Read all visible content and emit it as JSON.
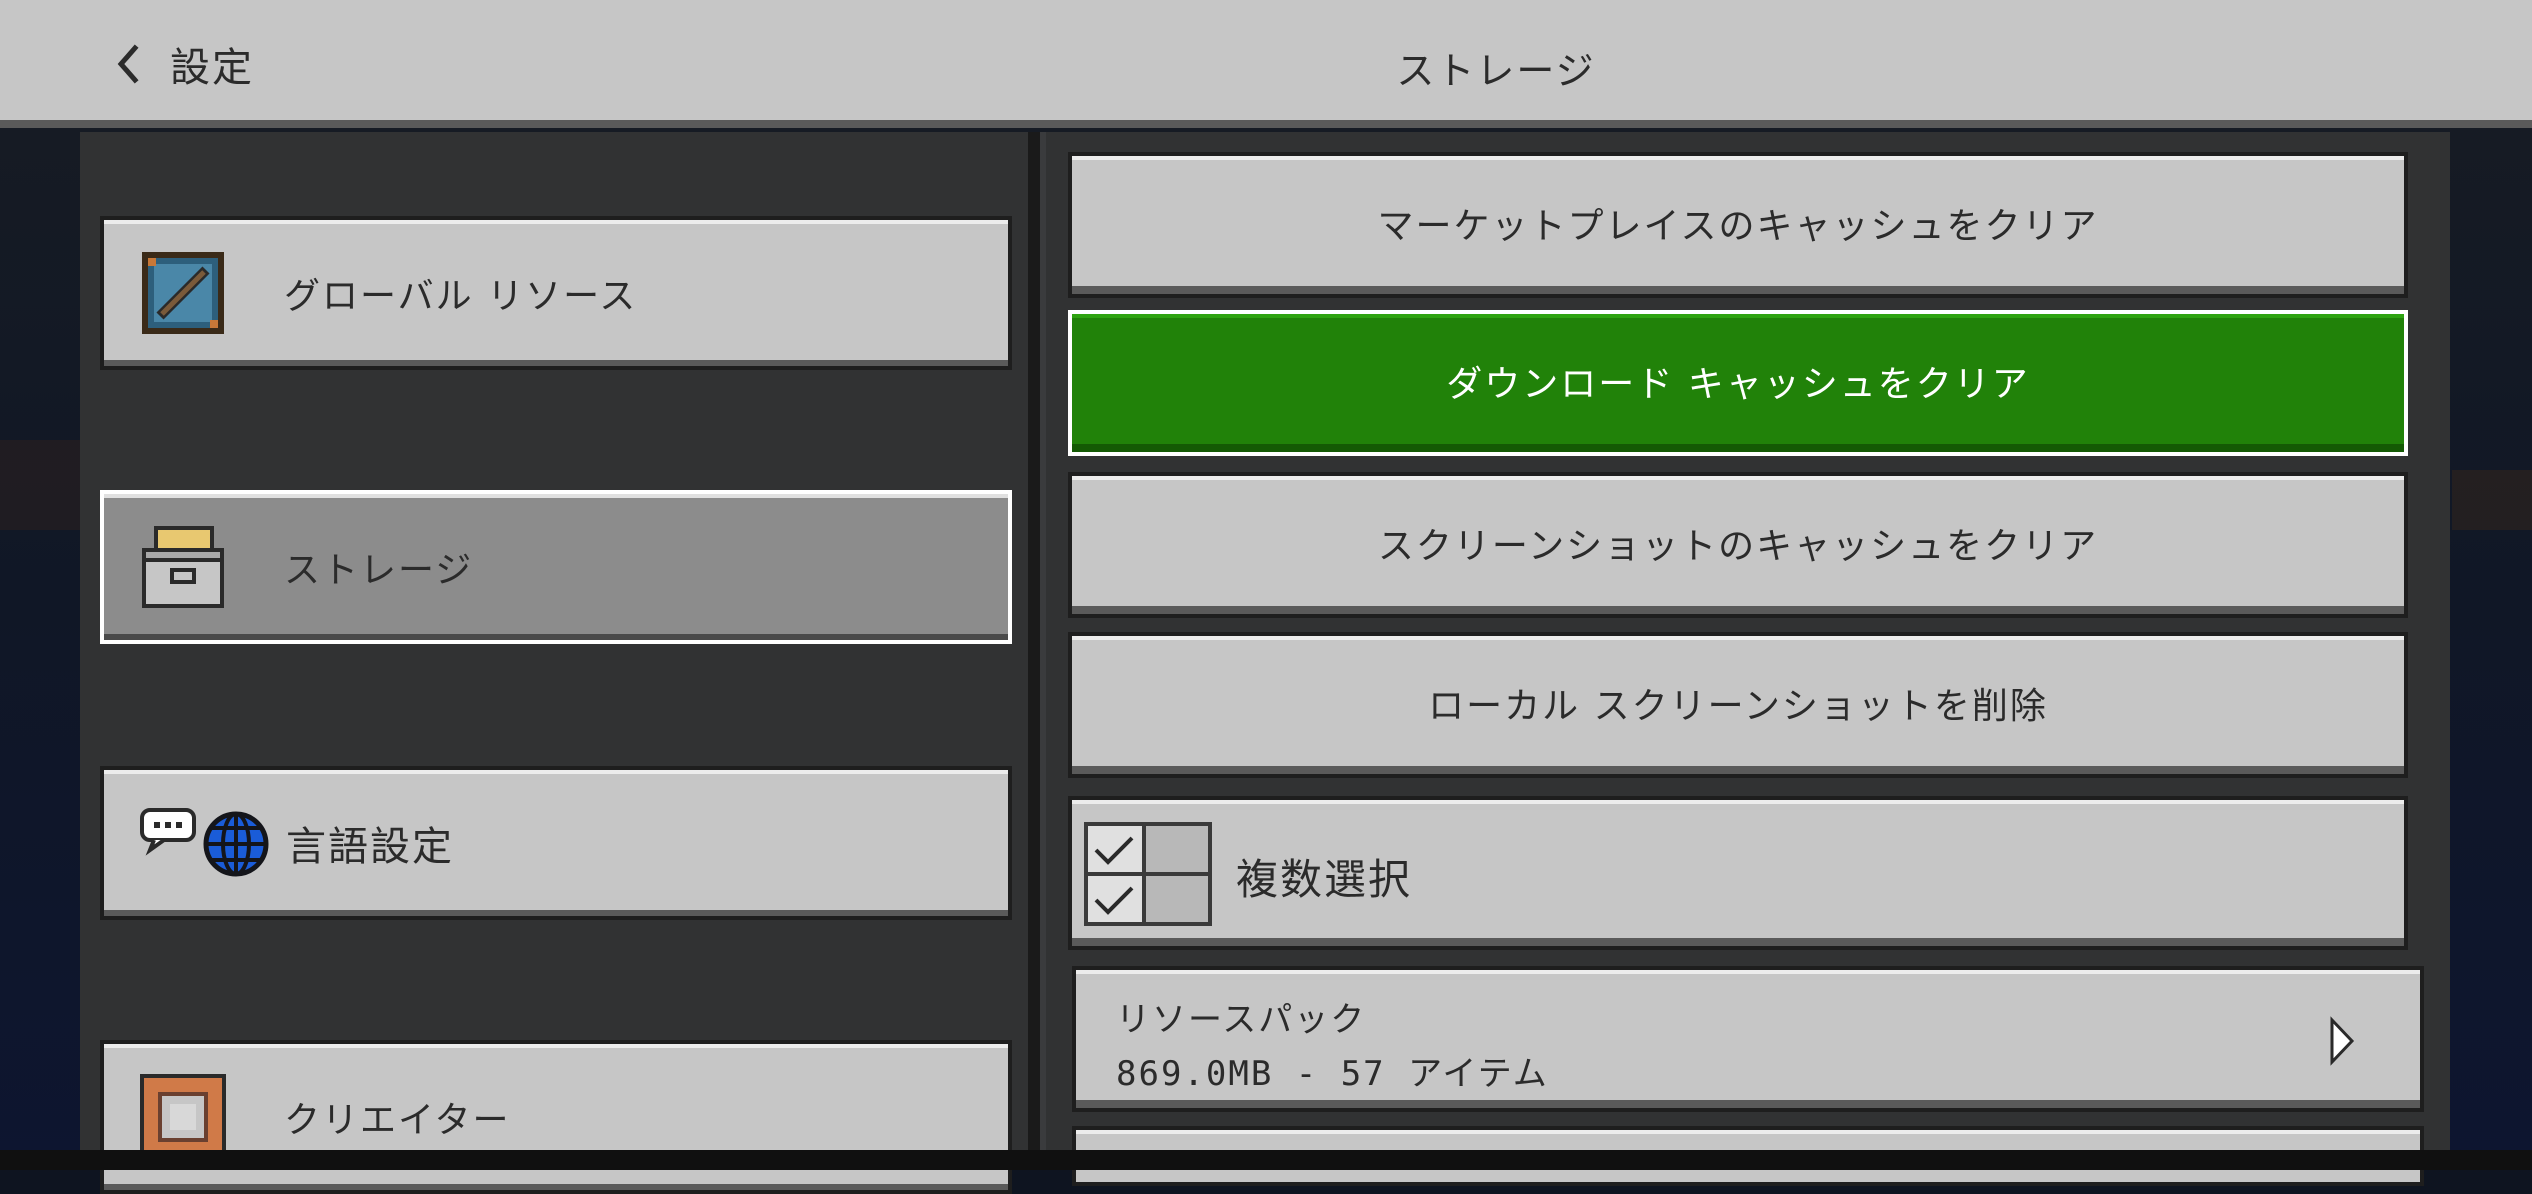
{
  "header": {
    "back_label": "設定",
    "title": "ストレージ"
  },
  "sidebar": {
    "items": [
      {
        "label": "グローバル リソース",
        "icon": "global-resources-icon"
      },
      {
        "label": "ストレージ",
        "icon": "storage-icon",
        "selected": true
      },
      {
        "label": "言語設定",
        "icon": "language-icon"
      },
      {
        "label": "クリエイター",
        "icon": "creator-icon"
      }
    ]
  },
  "actions": {
    "clear_marketplace_cache": "マーケットプレイスのキャッシュをクリア",
    "clear_download_cache": "ダウンロード キャッシュをクリア",
    "clear_screenshot_cache": "スクリーンショットのキャッシュをクリア",
    "delete_local_screenshots": "ローカル スクリーンショットを削除"
  },
  "multi_select": {
    "label": "複数選択"
  },
  "resource_pack": {
    "title": "リソースパック",
    "subtitle": "869.0MB - 57 アイテム"
  },
  "colors": {
    "primary_button": "#218209",
    "button_gray": "#c6c6c6",
    "panel": "#313233"
  }
}
